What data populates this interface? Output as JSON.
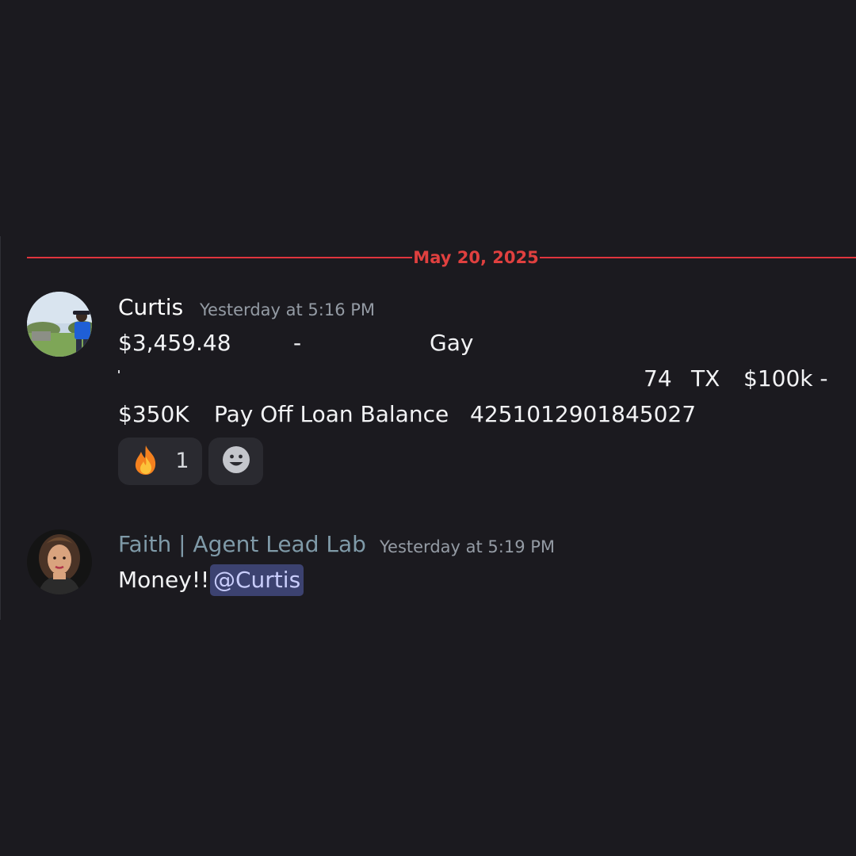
{
  "date_divider": {
    "label": "May 20, 2025",
    "color": "#e0403f"
  },
  "messages": [
    {
      "author": "Curtis",
      "author_color": "#ffffff",
      "timestamp": "Yesterday at 5:16 PM",
      "avatar_icon": "avatar-photo-man-outdoors",
      "lines": {
        "amount": "$3,459.48",
        "dash": "-",
        "name": "Gay",
        "age": "74",
        "state": "TX",
        "range_start": "$100k -",
        "range_end": "$350K",
        "purpose": "Pay Off Loan Balance",
        "reference": "4251012901845027"
      },
      "reactions": [
        {
          "emoji": "🔥",
          "icon": "fire-icon",
          "count": "1"
        },
        {
          "icon": "add-reaction-smiley-icon"
        }
      ]
    },
    {
      "author": "Faith | Agent Lead Lab",
      "author_color": "#7f9aa8",
      "timestamp": "Yesterday at 5:19 PM",
      "avatar_icon": "avatar-photo-woman",
      "text": "Money!!",
      "mention": "@Curtis"
    }
  ]
}
